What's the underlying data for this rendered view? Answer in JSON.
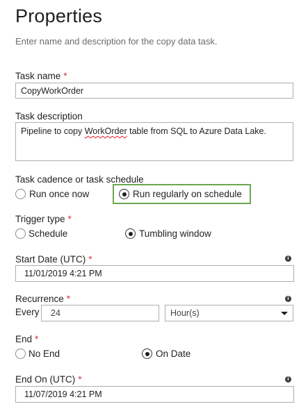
{
  "header": {
    "title": "Properties",
    "subtitle": "Enter name and description for the copy data task."
  },
  "task_name": {
    "label": "Task name",
    "required_mark": "*",
    "value": "CopyWorkOrder"
  },
  "task_description": {
    "label": "Task description",
    "value_before": "Pipeline to copy ",
    "value_misspelled": "WorkOrder",
    "value_after": " table from SQL to Azure Data Lake."
  },
  "cadence": {
    "label": "Task cadence or task schedule",
    "options": [
      {
        "label": "Run once now",
        "selected": false
      },
      {
        "label": "Run regularly on schedule",
        "selected": true
      }
    ],
    "highlight_color": "#6aa84f"
  },
  "trigger": {
    "label": "Trigger type",
    "required_mark": "*",
    "options": [
      {
        "label": "Schedule",
        "selected": false
      },
      {
        "label": "Tumbling window",
        "selected": true
      }
    ]
  },
  "start_date": {
    "label": "Start Date (UTC)",
    "required_mark": "*",
    "value": "11/01/2019 4:21 PM",
    "info_icon": "info-icon"
  },
  "recurrence": {
    "label": "Recurrence",
    "required_mark": "*",
    "every_label": "Every",
    "interval": "24",
    "unit": "Hour(s)",
    "info_icon": "info-icon"
  },
  "end": {
    "label": "End",
    "required_mark": "*",
    "options": [
      {
        "label": "No End",
        "selected": false
      },
      {
        "label": "On Date",
        "selected": true
      }
    ]
  },
  "end_on": {
    "label": "End On (UTC)",
    "required_mark": "*",
    "value": "11/07/2019 4:21 PM",
    "info_icon": "info-icon"
  },
  "colors": {
    "required": "#d13438",
    "border": "#adadad"
  }
}
